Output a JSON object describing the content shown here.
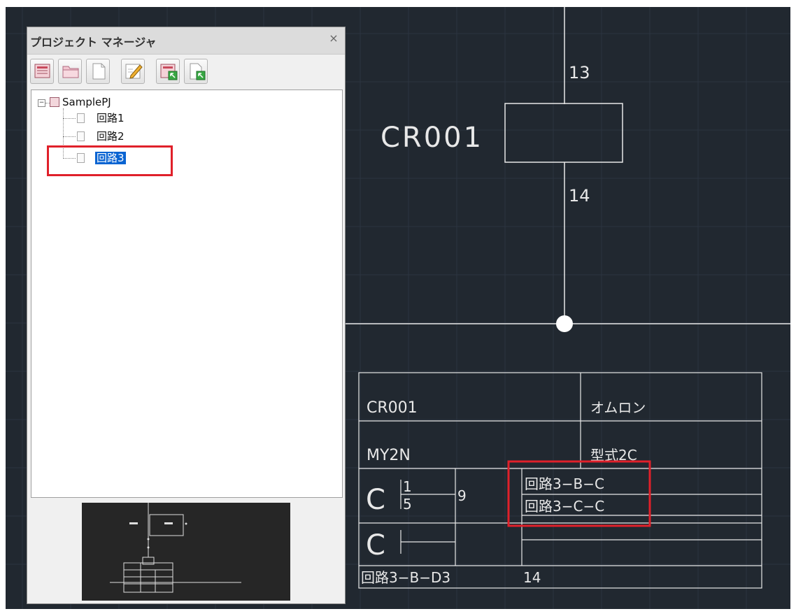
{
  "project_manager": {
    "title": "プロジェクト マネージャ",
    "close_glyph": "×",
    "toolbar": [
      {
        "icon": "new-project-icon"
      },
      {
        "icon": "open-folder-icon"
      },
      {
        "icon": "new-page-icon"
      },
      {
        "icon": "edit-pencil-icon"
      },
      {
        "icon": "import-project-icon"
      },
      {
        "icon": "import-page-icon"
      }
    ],
    "tree": {
      "project": "SamplePJ",
      "pages": [
        "回路1",
        "回路2",
        "回路3"
      ],
      "selected_page": "回路3"
    }
  },
  "drawing": {
    "component_tag": "CR001",
    "pin_top": "13",
    "pin_bottom": "14",
    "table": {
      "r1_left": "CR001",
      "r1_right": "オムロン",
      "r2_left": "MY2N",
      "r2_right": "型式2C",
      "contact_letter_1": "C",
      "contact_letter_2": "C",
      "frac_top": "1",
      "frac_bottom": "5",
      "pin_9": "9",
      "ref_1": "回路3−B−C",
      "ref_2": "回路3−C−C",
      "footer_ref": "回路3−B−Ⅾ3",
      "footer_num": "14"
    }
  },
  "colors": {
    "cad_background": "#212830",
    "grid": "#2c3440",
    "cad_line": "#e8e8e8",
    "highlight": "#e0202a",
    "selection": "#0a64d2"
  }
}
